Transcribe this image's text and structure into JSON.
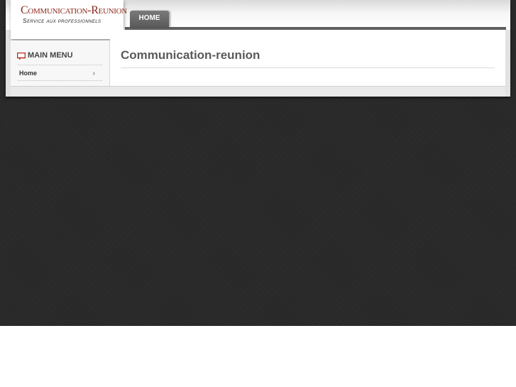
{
  "logo": {
    "title": "Communication-Reunion",
    "subtitle": "Service aux professionnels"
  },
  "nav": {
    "tabs": [
      {
        "label": "HOME"
      }
    ]
  },
  "sidebar": {
    "heading": "MAIN MENU",
    "icon": "speech-bubble-icon",
    "items": [
      {
        "label": "Home",
        "icon": "chevron-right-icon"
      }
    ]
  },
  "main": {
    "title": "Communication-reunion"
  },
  "colors": {
    "logo_accent": "#8a2a1c",
    "nav_tab": "#6a6a6a",
    "menu_icon": "#b3301e",
    "background": "#2b2b2b"
  }
}
